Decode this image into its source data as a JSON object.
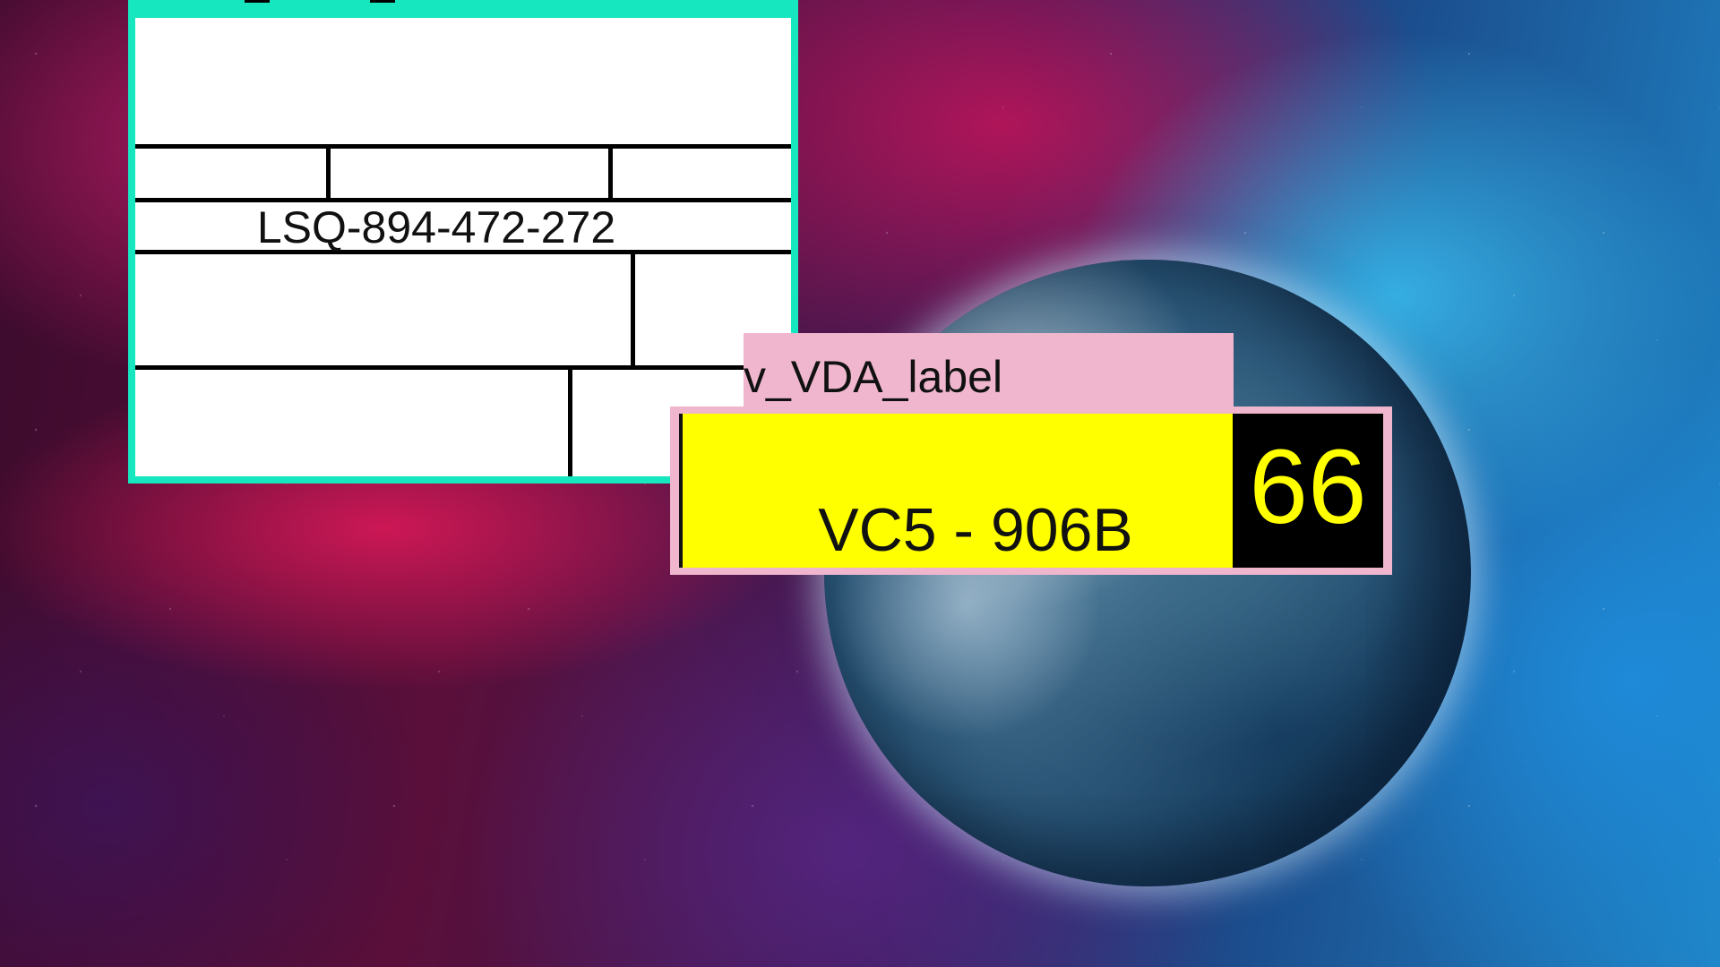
{
  "background": {
    "scene": "space-nebula-with-planet"
  },
  "info_card": {
    "accent_color": "#17e7bf",
    "code": "LSQ-894-472-272"
  },
  "label_tag": {
    "text": "v_VDA_label",
    "color": "#efb6cd"
  },
  "plate": {
    "code": "VC5 - 906B",
    "number": "66",
    "plate_color": "#ffff00",
    "number_color": "#ffff00"
  }
}
